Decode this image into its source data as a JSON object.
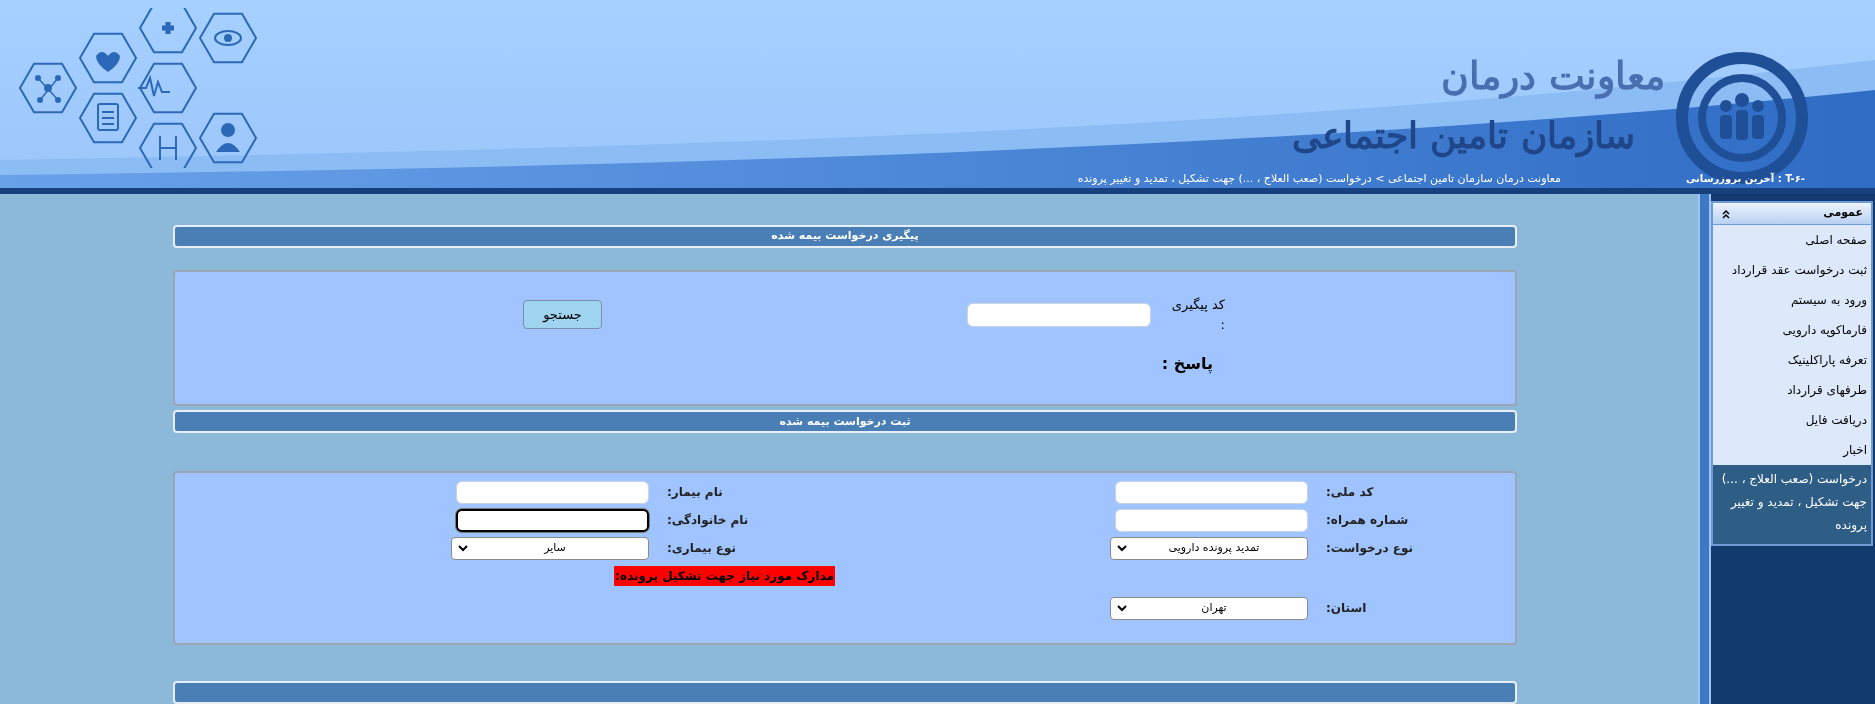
{
  "header": {
    "logo_title": "معاونت درمان",
    "logo_subtitle": "سازمان تامین اجتماعی",
    "last_update": "آخرین بروزرسانی : T-۶-",
    "breadcrumb": "معاونت درمان سازمان تامین اجتماعی > درخواست (صعب العلاج ، ...) جهت تشکیل ، تمدید و تغییر پرونده"
  },
  "tracking_section": {
    "title": "پیگیری درخواست بیمه شده",
    "field_label": "کد پیگیری :",
    "button": "جستجو",
    "response_label": "پاسخ :"
  },
  "request_section": {
    "title": "ثبت درخواست بیمه شده",
    "rows": [
      {
        "right": {
          "kind": "text",
          "label": "کد ملی:",
          "focused": false
        },
        "left": {
          "kind": "text",
          "label": "نام بیمار:",
          "focused": false
        }
      },
      {
        "right": {
          "kind": "text",
          "label": "شماره همراه:",
          "focused": false
        },
        "left": {
          "kind": "text",
          "label": "نام خانوادگی:",
          "focused": true
        }
      },
      {
        "right": {
          "kind": "select",
          "label": "نوع درخواست:",
          "value": "تمدید پرونده دارویی"
        },
        "left": {
          "kind": "select",
          "label": "نوع بیماری:",
          "value": "سایر"
        }
      },
      {
        "left": {
          "kind": "notice",
          "text": "مدارک مورد نیاز جهت تشکیل پرونده:",
          "color": "#ff0000"
        }
      },
      {
        "right": {
          "kind": "select",
          "label": "استان:",
          "value": "تهران"
        }
      }
    ]
  },
  "sidebar": {
    "title": "عمومی",
    "expanded": true,
    "items": [
      {
        "label": "صفحه اصلی",
        "selected": false
      },
      {
        "label": "ثبت درخواست عقد قرارداد",
        "selected": false
      },
      {
        "label": "ورود به سیستم",
        "selected": false
      },
      {
        "label": "فارماکوپه دارویی",
        "selected": false
      },
      {
        "label": "تعرفه پاراکلینیک",
        "selected": false
      },
      {
        "label": "طرفهای قرارداد",
        "selected": false
      },
      {
        "label": "دریافت فایل",
        "selected": false
      },
      {
        "label": "اخبار",
        "selected": false
      },
      {
        "label": "درخواست (صعب العلاج ، ...) جهت تشکیل ، تمدید و تغییر پرونده",
        "selected": true
      }
    ]
  }
}
